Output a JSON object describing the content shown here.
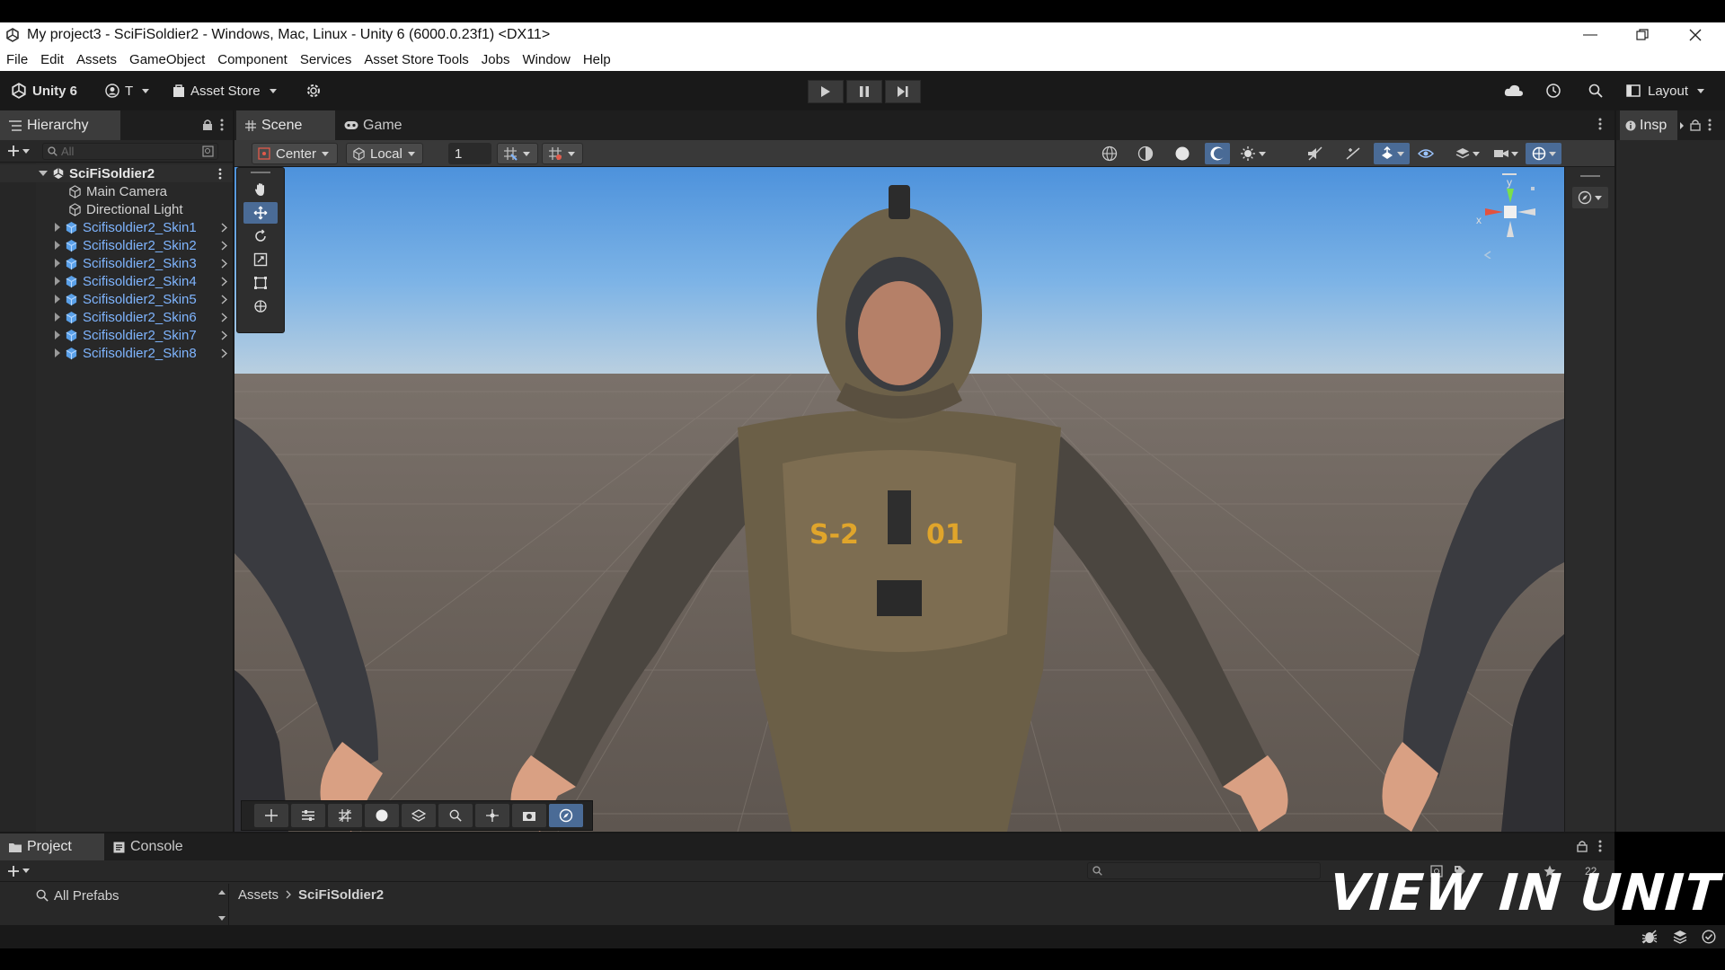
{
  "window": {
    "title": "My project3 - SciFiSoldier2 - Windows, Mac, Linux - Unity 6 (6000.0.23f1) <DX11>"
  },
  "menu": [
    "File",
    "Edit",
    "Assets",
    "GameObject",
    "Component",
    "Services",
    "Asset Store Tools",
    "Jobs",
    "Window",
    "Help"
  ],
  "toolbar": {
    "unity_label": "Unity 6",
    "account_label": "T",
    "asset_store_label": "Asset Store",
    "layout_label": "Layout"
  },
  "hierarchy": {
    "tab_label": "Hierarchy",
    "search_placeholder": "All",
    "scene_name": "SciFiSoldier2",
    "items": [
      {
        "label": "Main Camera",
        "prefab": false
      },
      {
        "label": "Directional Light",
        "prefab": false
      },
      {
        "label": "Scifisoldier2_Skin1",
        "prefab": true
      },
      {
        "label": "Scifisoldier2_Skin2",
        "prefab": true
      },
      {
        "label": "Scifisoldier2_Skin3",
        "prefab": true
      },
      {
        "label": "Scifisoldier2_Skin4",
        "prefab": true
      },
      {
        "label": "Scifisoldier2_Skin5",
        "prefab": true
      },
      {
        "label": "Scifisoldier2_Skin6",
        "prefab": true
      },
      {
        "label": "Scifisoldier2_Skin7",
        "prefab": true
      },
      {
        "label": "Scifisoldier2_Skin8",
        "prefab": true
      }
    ]
  },
  "scene": {
    "tab_scene": "Scene",
    "tab_game": "Game",
    "pivot_mode": "Center",
    "pivot_rotation": "Local",
    "grid_snap_value": "1",
    "chest_text_left": "S-2",
    "chest_text_right": "01",
    "gizmo_y": "y",
    "gizmo_x": "x"
  },
  "inspector": {
    "tab_label": "Insp"
  },
  "project": {
    "tab_project": "Project",
    "tab_console": "Console",
    "favorites_item": "All Prefabs",
    "breadcrumb_root": "Assets",
    "breadcrumb_current": "SciFiSoldier2",
    "item_count": "22"
  },
  "watermark": "VIEW IN UNITY",
  "colors": {
    "editor_bg": "#282828",
    "toolbar_bg": "#191919",
    "prefab_blue": "#7fb5ff",
    "selection_blue": "#4a6b96",
    "chest_text": "#e0a52b"
  }
}
